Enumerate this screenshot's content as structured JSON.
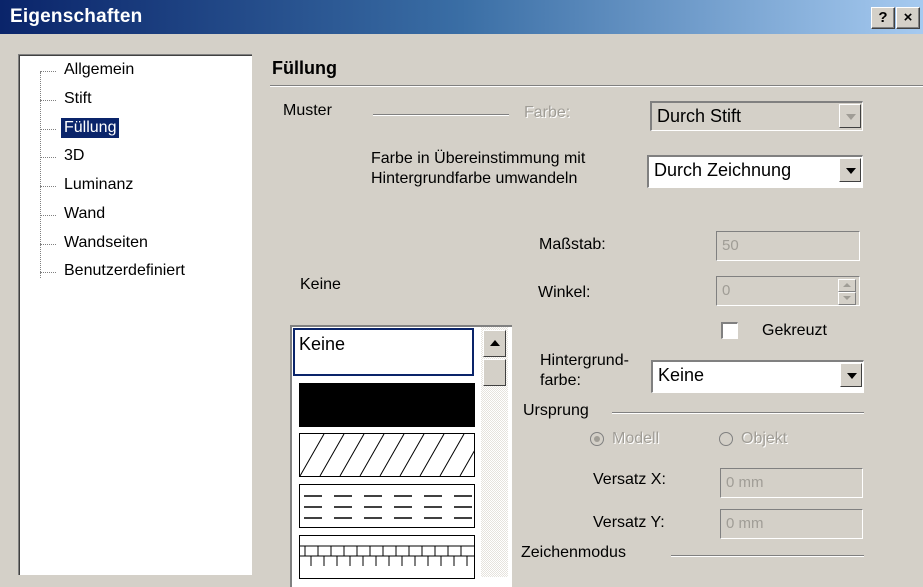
{
  "window": {
    "title": "Eigenschaften",
    "help_glyph": "?",
    "close_glyph": "×"
  },
  "sidebar": {
    "items": [
      {
        "label": "Allgemein"
      },
      {
        "label": "Stift"
      },
      {
        "label": "Füllung",
        "selected": true
      },
      {
        "label": "3D"
      },
      {
        "label": "Luminanz"
      },
      {
        "label": "Wand"
      },
      {
        "label": "Wandseiten"
      },
      {
        "label": "Benutzerdefiniert"
      }
    ]
  },
  "main": {
    "section_title": "Füllung",
    "muster_label": "Muster",
    "farbe_label": "Farbe:",
    "farbe_value": "Durch Stift",
    "convert_label_line1": "Farbe in Übereinstimmung mit",
    "convert_label_line2": "Hintergrundfarbe umwandeln",
    "convert_value": "Durch Zeichnung",
    "pattern_name": "Keine",
    "massstab_label": "Maßstab:",
    "massstab_value": "50",
    "winkel_label": "Winkel:",
    "winkel_value": "0",
    "gekreuzt_label": "Gekreuzt",
    "hintergrund_label_line1": "Hintergrund-",
    "hintergrund_label_line2": "farbe:",
    "hintergrund_value": "Keine",
    "ursprung_label": "Ursprung",
    "modell_label": "Modell",
    "objekt_label": "Objekt",
    "versatz_x_label": "Versatz X:",
    "versatz_x_value": "0 mm",
    "versatz_y_label": "Versatz Y:",
    "versatz_y_value": "0 mm",
    "zeichenmodus_label": "Zeichenmodus",
    "pattern_list": {
      "selected": "Keine",
      "items": [
        "Keine",
        "solid",
        "diagonal-hatch",
        "dashed-lines",
        "brick"
      ]
    }
  },
  "colors": {
    "titlebar_start": "#0a246a",
    "titlebar_end": "#a6caf0",
    "dialog_bg": "#d4d0c8",
    "selection": "#0a246a",
    "disabled_text": "#a09d96"
  }
}
